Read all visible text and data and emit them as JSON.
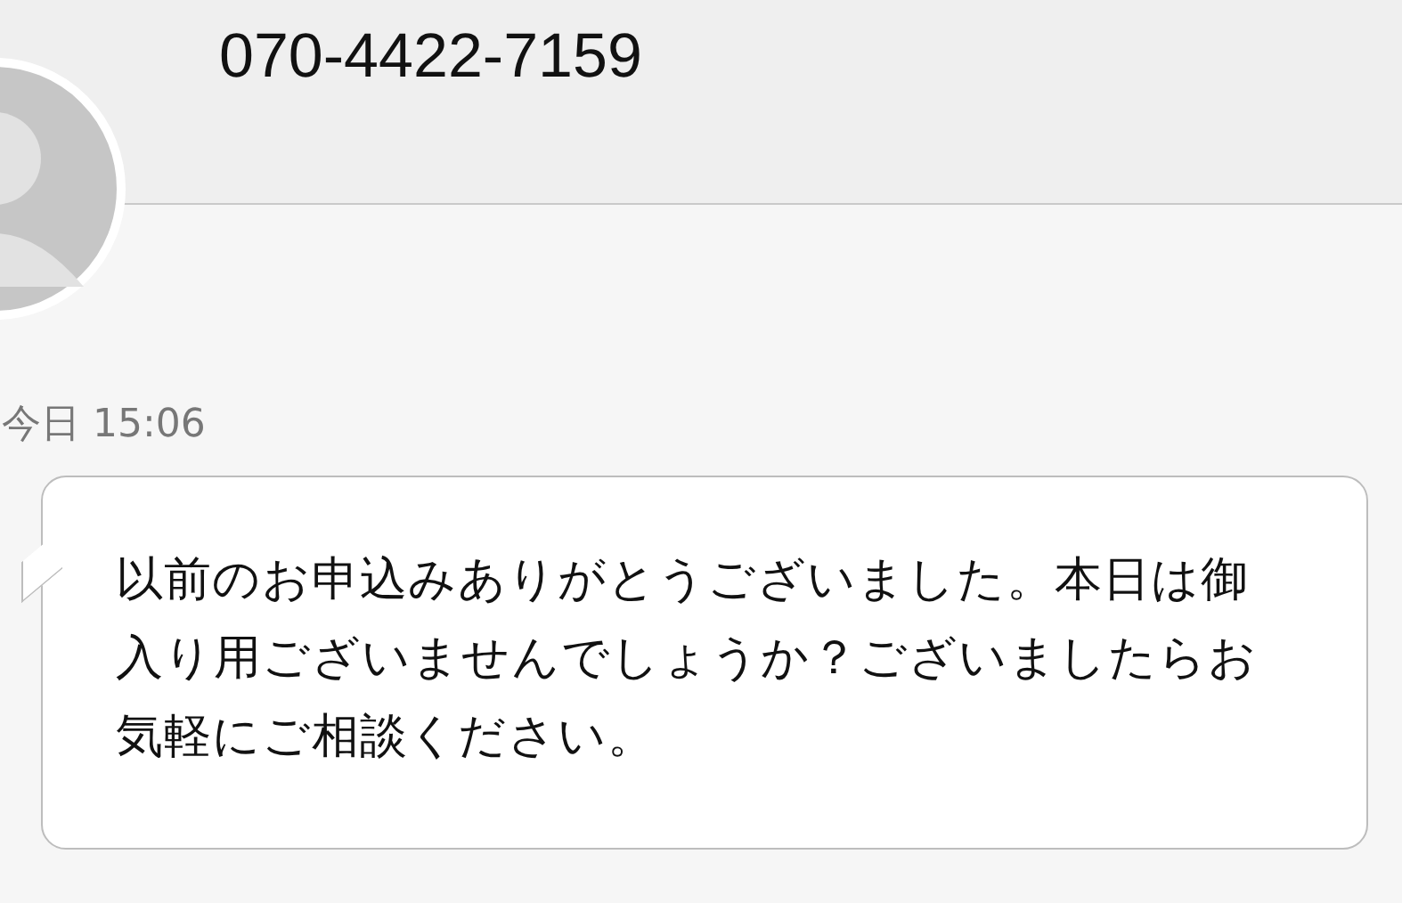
{
  "header": {
    "phone_number": "070-4422-7159"
  },
  "messages": [
    {
      "kind": "incoming",
      "time": "今日 15:06",
      "text": "以前のお申込みありがとうございました。本日は御入り用ございませんでしょうか？ございましたらお気軽にご相談ください。"
    }
  ]
}
